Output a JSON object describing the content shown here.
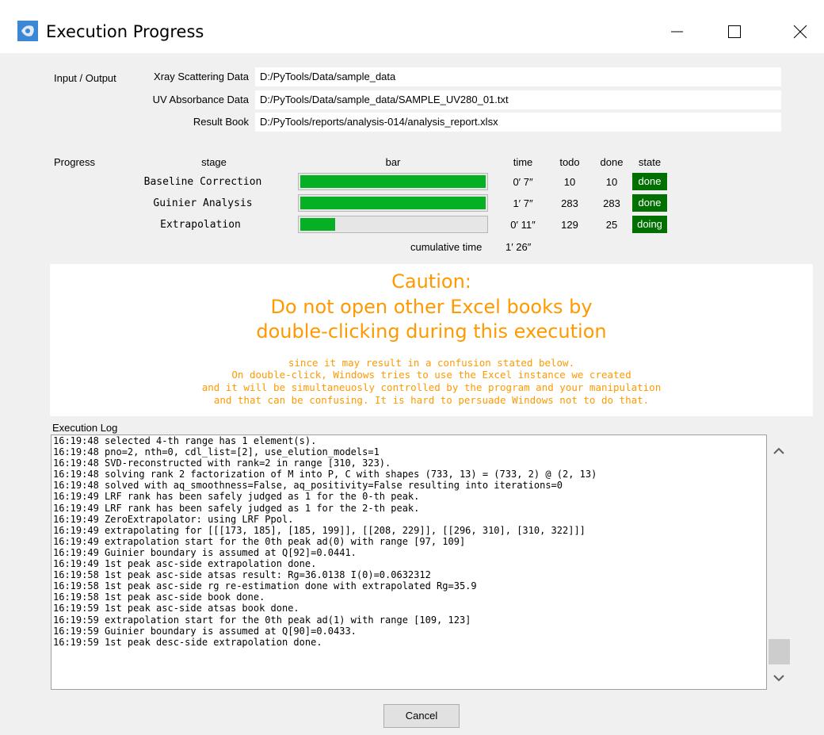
{
  "window": {
    "title": "Execution Progress",
    "colors": {
      "title_bg": "#ffffff",
      "body_bg": "#f0f0f0"
    }
  },
  "io": {
    "section_label": "Input / Output",
    "rows": [
      {
        "label": "Xray Scattering Data",
        "value": "D:/PyTools/Data/sample_data"
      },
      {
        "label": "UV Absorbance Data",
        "value": "D:/PyTools/Data/sample_data/SAMPLE_UV280_01.txt"
      },
      {
        "label": "Result Book",
        "value": "D:/PyTools/reports/analysis-014/analysis_report.xlsx"
      }
    ]
  },
  "progress": {
    "section_label": "Progress",
    "headers": {
      "stage": "stage",
      "bar": "bar",
      "time": "time",
      "todo": "todo",
      "done": "done",
      "state": "state"
    },
    "rows": [
      {
        "stage": "Baseline Correction",
        "fill": 1.0,
        "time": "0′ 7″",
        "todo": "10",
        "done": "10",
        "state": "done"
      },
      {
        "stage": "Guinier Analysis",
        "fill": 1.0,
        "time": "1′ 7″",
        "todo": "283",
        "done": "283",
        "state": "done"
      },
      {
        "stage": "Extrapolation",
        "fill": 0.19,
        "time": "0′ 11″",
        "todo": "129",
        "done": "25",
        "state": "doing"
      }
    ],
    "cumulative_label": "cumulative time",
    "cumulative_value": "1′ 26″",
    "colors": {
      "bar_fill": "#06b025",
      "state_bg": "#007000"
    }
  },
  "caution": {
    "heading_1": "Caution:",
    "heading_2": "Do not open other Excel books by",
    "heading_3": "double-clicking during this execution",
    "detail_1": "since it may result in a confusion stated below.",
    "detail_2": "On double-click, Windows tries to use the Excel instance we created",
    "detail_3": "and it will be simultaneuosly controlled by the program and your manipulation",
    "detail_4": "and that can be confusing. It is hard to persuade Windows not to do that.",
    "color": "#ff9900"
  },
  "log": {
    "label": "Execution Log",
    "lines": [
      "16:19:48 selected 4-th range has 1 element(s).",
      "16:19:48 pno=2, nth=0, cdl_list=[2], use_elution_models=1",
      "16:19:48 SVD-reconstructed with rank=2 in range [310, 323).",
      "16:19:48 solving rank 2 factorization of M into P, C with shapes (733, 13) = (733, 2) @ (2, 13)",
      "16:19:48 solved with aq_smoothness=False, aq_positivity=False resulting into iterations=0",
      "16:19:49 LRF rank has been safely judged as 1 for the 0-th peak.",
      "16:19:49 LRF rank has been safely judged as 1 for the 2-th peak.",
      "16:19:49 ZeroExtrapolator: using LRF Ppol.",
      "16:19:49 extrapolating for [[[173, 185], [185, 199]], [[208, 229]], [[296, 310], [310, 322]]]",
      "16:19:49 extrapolation start for the 0th peak ad(0) with range [97, 109]",
      "16:19:49 Guinier boundary is assumed at Q[92]=0.0441.",
      "16:19:49 1st peak asc-side extrapolation done.",
      "16:19:58 1st peak asc-side atsas result: Rg=36.0138 I(0)=0.0632312",
      "16:19:58 1st peak asc-side rg re-estimation done with extrapolated Rg=35.9",
      "16:19:58 1st peak asc-side book done.",
      "16:19:59 1st peak asc-side atsas book done.",
      "16:19:59 extrapolation start for the 0th peak ad(1) with range [109, 123]",
      "16:19:59 Guinier boundary is assumed at Q[90]=0.0433.",
      "16:19:59 1st peak desc-side extrapolation done."
    ]
  },
  "footer": {
    "cancel_label": "Cancel"
  }
}
